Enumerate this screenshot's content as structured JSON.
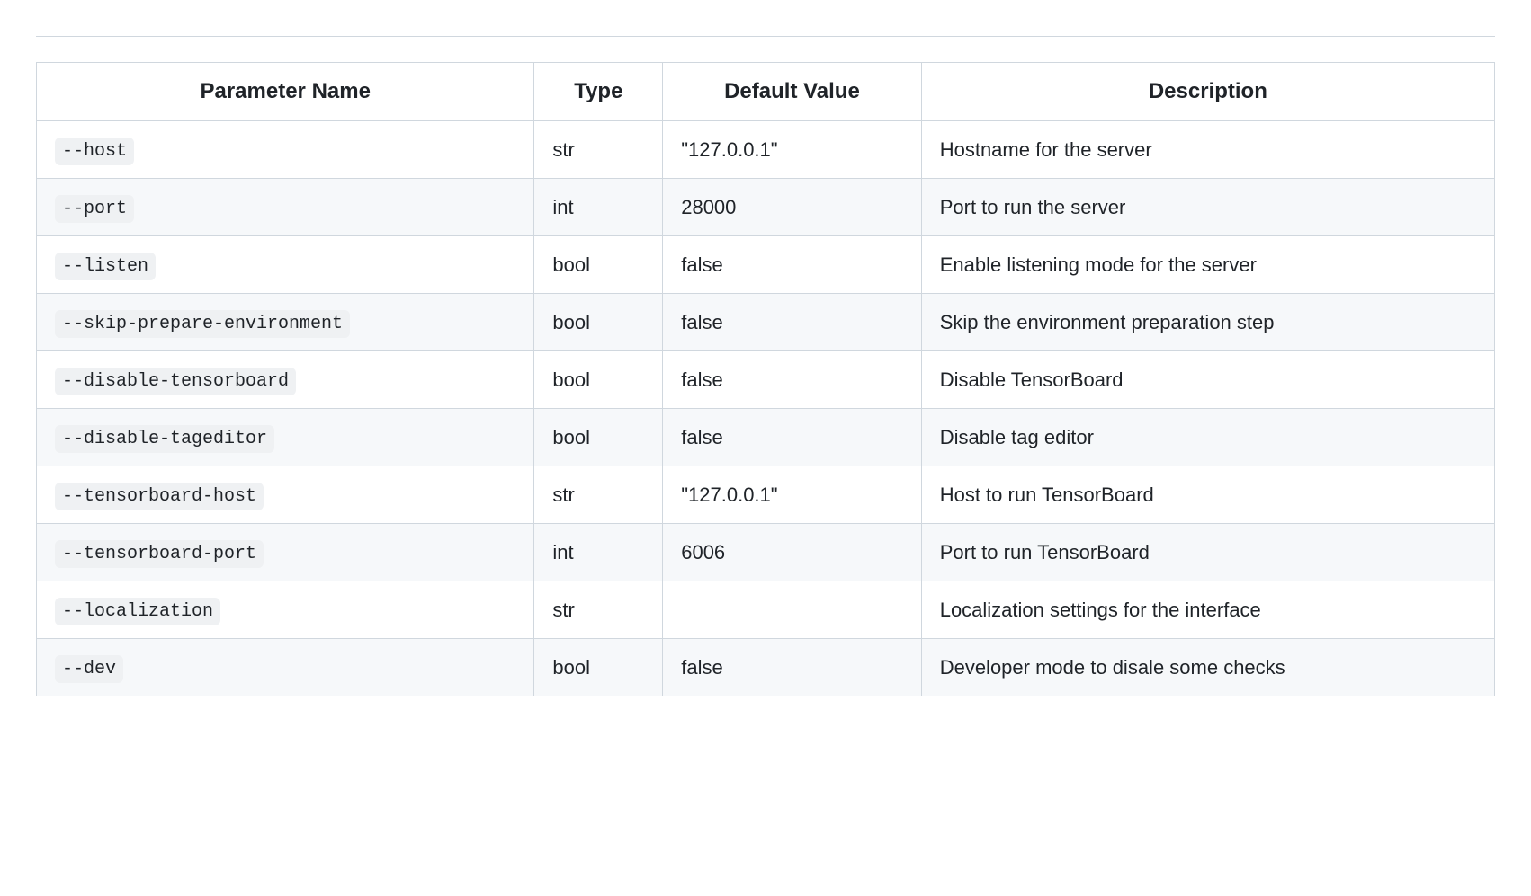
{
  "headers": {
    "name": "Parameter Name",
    "type": "Type",
    "default": "Default Value",
    "description": "Description"
  },
  "rows": [
    {
      "name": "--host",
      "type": "str",
      "default": "\"127.0.0.1\"",
      "description": "Hostname for the server"
    },
    {
      "name": "--port",
      "type": "int",
      "default": "28000",
      "description": "Port to run the server"
    },
    {
      "name": "--listen",
      "type": "bool",
      "default": "false",
      "description": "Enable listening mode for the server"
    },
    {
      "name": "--skip-prepare-environment",
      "type": "bool",
      "default": "false",
      "description": "Skip the environment preparation step"
    },
    {
      "name": "--disable-tensorboard",
      "type": "bool",
      "default": "false",
      "description": "Disable TensorBoard"
    },
    {
      "name": "--disable-tageditor",
      "type": "bool",
      "default": "false",
      "description": "Disable tag editor"
    },
    {
      "name": "--tensorboard-host",
      "type": "str",
      "default": "\"127.0.0.1\"",
      "description": "Host to run TensorBoard"
    },
    {
      "name": "--tensorboard-port",
      "type": "int",
      "default": "6006",
      "description": "Port to run TensorBoard"
    },
    {
      "name": "--localization",
      "type": "str",
      "default": "",
      "description": "Localization settings for the interface"
    },
    {
      "name": "--dev",
      "type": "bool",
      "default": "false",
      "description": "Developer mode to disale some checks"
    }
  ]
}
